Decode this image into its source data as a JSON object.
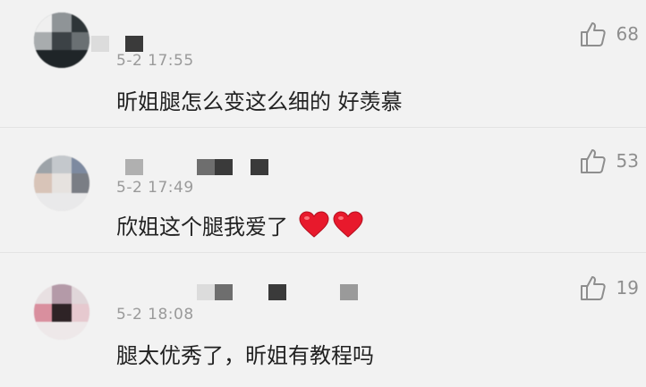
{
  "comments": [
    {
      "time": "5-2 17:55",
      "text": "昕姐腿怎么变这么细的 好羡慕",
      "likes": "68",
      "icon": "thumbs-up-icon"
    },
    {
      "time": "5-2 17:49",
      "text": "欣姐这个腿我爱了",
      "emoji": "❤️❤️",
      "likes": "53",
      "icon": "thumbs-up-icon"
    },
    {
      "time": "5-2 18:08",
      "text": "腿太优秀了，昕姐有教程吗",
      "likes": "19",
      "icon": "thumbs-up-icon"
    }
  ],
  "colors": {
    "background": "#f2f2f2",
    "text": "#222222",
    "muted": "#9a9a9a",
    "heart": "#e8192c"
  }
}
